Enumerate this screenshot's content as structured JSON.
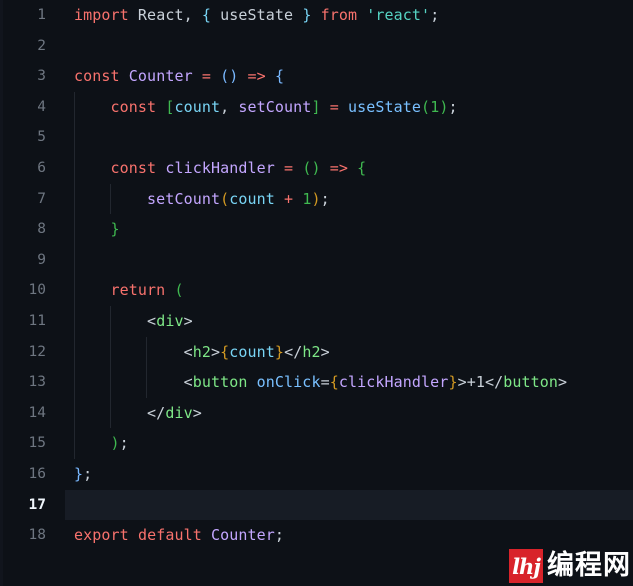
{
  "editor": {
    "background_color": "#0d1117",
    "active_line_color": "#171c25",
    "gutter_color": "#6e7681",
    "active_gutter_color": "#f0f6fc",
    "active_line_number": 17,
    "total_lines": 18,
    "language": "jsx",
    "tab_size": 4
  },
  "line_numbers": [
    "1",
    "2",
    "3",
    "4",
    "5",
    "6",
    "7",
    "8",
    "9",
    "10",
    "11",
    "12",
    "13",
    "14",
    "15",
    "16",
    "17",
    "18"
  ],
  "code": {
    "lines": [
      {
        "number": "1",
        "indent": 0,
        "tokens": [
          {
            "text": "import",
            "cls": "t-kw"
          },
          {
            "text": " React",
            "cls": "t-plain"
          },
          {
            "text": ", ",
            "cls": "t-plain"
          },
          {
            "text": "{",
            "cls": "t-param"
          },
          {
            "text": " useState ",
            "cls": "t-plain"
          },
          {
            "text": "}",
            "cls": "t-param"
          },
          {
            "text": " ",
            "cls": "t-plain"
          },
          {
            "text": "from",
            "cls": "t-kw"
          },
          {
            "text": " ",
            "cls": "t-plain"
          },
          {
            "text": "'react'",
            "cls": "t-str"
          },
          {
            "text": ";",
            "cls": "t-plain"
          }
        ]
      },
      {
        "number": "2",
        "indent": 0,
        "tokens": []
      },
      {
        "number": "3",
        "indent": 0,
        "tokens": [
          {
            "text": "const",
            "cls": "t-kw"
          },
          {
            "text": " ",
            "cls": "t-plain"
          },
          {
            "text": "Counter",
            "cls": "t-var"
          },
          {
            "text": " ",
            "cls": "t-plain"
          },
          {
            "text": "=",
            "cls": "t-kw"
          },
          {
            "text": " ",
            "cls": "t-plain"
          },
          {
            "text": "()",
            "cls": "t-br1"
          },
          {
            "text": " ",
            "cls": "t-plain"
          },
          {
            "text": "=>",
            "cls": "t-kw"
          },
          {
            "text": " ",
            "cls": "t-plain"
          },
          {
            "text": "{",
            "cls": "t-br1"
          }
        ]
      },
      {
        "number": "4",
        "indent": 1,
        "tokens": [
          {
            "text": "    ",
            "cls": "t-plain"
          },
          {
            "text": "const",
            "cls": "t-kw"
          },
          {
            "text": " ",
            "cls": "t-plain"
          },
          {
            "text": "[",
            "cls": "t-br2"
          },
          {
            "text": "count",
            "cls": "t-param"
          },
          {
            "text": ", ",
            "cls": "t-plain"
          },
          {
            "text": "setCount",
            "cls": "t-var"
          },
          {
            "text": "]",
            "cls": "t-br2"
          },
          {
            "text": " ",
            "cls": "t-plain"
          },
          {
            "text": "=",
            "cls": "t-kw"
          },
          {
            "text": " ",
            "cls": "t-plain"
          },
          {
            "text": "useState",
            "cls": "t-prop"
          },
          {
            "text": "(",
            "cls": "t-br2"
          },
          {
            "text": "1",
            "cls": "t-num"
          },
          {
            "text": ")",
            "cls": "t-br2"
          },
          {
            "text": ";",
            "cls": "t-plain"
          }
        ]
      },
      {
        "number": "5",
        "indent": 1,
        "tokens": []
      },
      {
        "number": "6",
        "indent": 1,
        "tokens": [
          {
            "text": "    ",
            "cls": "t-plain"
          },
          {
            "text": "const",
            "cls": "t-kw"
          },
          {
            "text": " ",
            "cls": "t-plain"
          },
          {
            "text": "clickHandler",
            "cls": "t-var"
          },
          {
            "text": " ",
            "cls": "t-plain"
          },
          {
            "text": "=",
            "cls": "t-kw"
          },
          {
            "text": " ",
            "cls": "t-plain"
          },
          {
            "text": "()",
            "cls": "t-br2"
          },
          {
            "text": " ",
            "cls": "t-plain"
          },
          {
            "text": "=>",
            "cls": "t-kw"
          },
          {
            "text": " ",
            "cls": "t-plain"
          },
          {
            "text": "{",
            "cls": "t-br2"
          }
        ]
      },
      {
        "number": "7",
        "indent": 2,
        "tokens": [
          {
            "text": "        ",
            "cls": "t-plain"
          },
          {
            "text": "setCount",
            "cls": "t-var"
          },
          {
            "text": "(",
            "cls": "t-br3"
          },
          {
            "text": "count",
            "cls": "t-param"
          },
          {
            "text": " ",
            "cls": "t-plain"
          },
          {
            "text": "+",
            "cls": "t-kw"
          },
          {
            "text": " ",
            "cls": "t-plain"
          },
          {
            "text": "1",
            "cls": "t-num"
          },
          {
            "text": ")",
            "cls": "t-br3"
          },
          {
            "text": ";",
            "cls": "t-plain"
          }
        ]
      },
      {
        "number": "8",
        "indent": 1,
        "tokens": [
          {
            "text": "    ",
            "cls": "t-plain"
          },
          {
            "text": "}",
            "cls": "t-br2"
          }
        ]
      },
      {
        "number": "9",
        "indent": 1,
        "tokens": []
      },
      {
        "number": "10",
        "indent": 1,
        "tokens": [
          {
            "text": "    ",
            "cls": "t-plain"
          },
          {
            "text": "return",
            "cls": "t-kw"
          },
          {
            "text": " ",
            "cls": "t-plain"
          },
          {
            "text": "(",
            "cls": "t-br2"
          }
        ]
      },
      {
        "number": "11",
        "indent": 2,
        "tokens": [
          {
            "text": "        ",
            "cls": "t-plain"
          },
          {
            "text": "<",
            "cls": "t-plain"
          },
          {
            "text": "div",
            "cls": "t-tag"
          },
          {
            "text": ">",
            "cls": "t-plain"
          }
        ]
      },
      {
        "number": "12",
        "indent": 3,
        "tokens": [
          {
            "text": "            ",
            "cls": "t-plain"
          },
          {
            "text": "<",
            "cls": "t-plain"
          },
          {
            "text": "h2",
            "cls": "t-tag"
          },
          {
            "text": ">",
            "cls": "t-plain"
          },
          {
            "text": "{",
            "cls": "t-br3"
          },
          {
            "text": "count",
            "cls": "t-param"
          },
          {
            "text": "}",
            "cls": "t-br3"
          },
          {
            "text": "</",
            "cls": "t-plain"
          },
          {
            "text": "h2",
            "cls": "t-tag"
          },
          {
            "text": ">",
            "cls": "t-plain"
          }
        ]
      },
      {
        "number": "13",
        "indent": 3,
        "tokens": [
          {
            "text": "            ",
            "cls": "t-plain"
          },
          {
            "text": "<",
            "cls": "t-plain"
          },
          {
            "text": "button",
            "cls": "t-tag"
          },
          {
            "text": " ",
            "cls": "t-plain"
          },
          {
            "text": "onClick",
            "cls": "t-prop"
          },
          {
            "text": "=",
            "cls": "t-plain"
          },
          {
            "text": "{",
            "cls": "t-br3"
          },
          {
            "text": "clickHandler",
            "cls": "t-var"
          },
          {
            "text": "}",
            "cls": "t-br3"
          },
          {
            "text": ">",
            "cls": "t-plain"
          },
          {
            "text": "+1",
            "cls": "t-plain"
          },
          {
            "text": "</",
            "cls": "t-plain"
          },
          {
            "text": "button",
            "cls": "t-tag"
          },
          {
            "text": ">",
            "cls": "t-plain"
          }
        ]
      },
      {
        "number": "14",
        "indent": 2,
        "tokens": [
          {
            "text": "        ",
            "cls": "t-plain"
          },
          {
            "text": "</",
            "cls": "t-plain"
          },
          {
            "text": "div",
            "cls": "t-tag"
          },
          {
            "text": ">",
            "cls": "t-plain"
          }
        ]
      },
      {
        "number": "15",
        "indent": 1,
        "tokens": [
          {
            "text": "    ",
            "cls": "t-plain"
          },
          {
            "text": ")",
            "cls": "t-br2"
          },
          {
            "text": ";",
            "cls": "t-plain"
          }
        ]
      },
      {
        "number": "16",
        "indent": 0,
        "tokens": [
          {
            "text": "}",
            "cls": "t-br1"
          },
          {
            "text": ";",
            "cls": "t-plain"
          }
        ]
      },
      {
        "number": "17",
        "indent": 0,
        "tokens": [],
        "active": true
      },
      {
        "number": "18",
        "indent": 0,
        "tokens": [
          {
            "text": "export",
            "cls": "t-kw"
          },
          {
            "text": " ",
            "cls": "t-plain"
          },
          {
            "text": "default",
            "cls": "t-kw"
          },
          {
            "text": " ",
            "cls": "t-plain"
          },
          {
            "text": "Counter",
            "cls": "t-var"
          },
          {
            "text": ";",
            "cls": "t-plain"
          }
        ]
      }
    ]
  },
  "watermark": {
    "badge_text": "lhj",
    "label": "编程网",
    "badge_color": "#d8232a",
    "text_color": "#ffffff"
  }
}
